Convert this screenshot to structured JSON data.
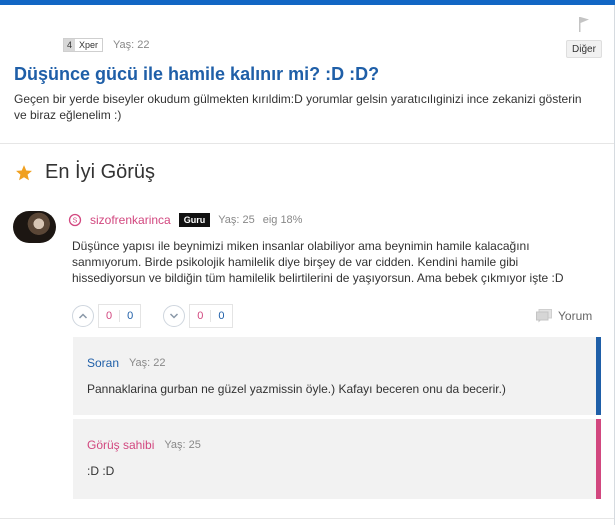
{
  "question": {
    "level": "4",
    "level_name": "Xper",
    "age": "Yaş: 22",
    "other_button": "Diğer",
    "title": "Düşünce gücü ile hamile kalınır mi? :D :D?",
    "body": "Geçen bir yerde biseyler okudum gülmekten kırıldim:D yorumlar gelsin yaratıcılıginizi ince zekanizi gösterin ve biraz eğlenelim :)"
  },
  "best_opinion": {
    "heading": "En İyi Görüş",
    "username": "sizofrenkarinca",
    "rank_badge": "Guru",
    "age": "Yaş: 25",
    "status": "eig 18%",
    "body": "Düşünce yapısı ile beynimizi miken insanlar olabiliyor ama beynimin hamile kalacağını sanmıyorum. Birde psikolojik hamilelik diye birşey de var cidden. Kendini hamile gibi hissediyorsun ve bildiğin tüm hamilelik belirtilerini de yaşıyorsun. Ama bebek çıkmıyor işte :D",
    "upvote": {
      "positive": "0",
      "negative": "0"
    },
    "downvote": {
      "positive": "0",
      "negative": "0"
    },
    "comment_label": "Yorum"
  },
  "replies": [
    {
      "username": "Soran",
      "age": "Yaş: 22",
      "body": "Pannaklarina gurban ne güzel yazmissin öyle.) Kafayı beceren onu da becerir.)"
    },
    {
      "username": "Görüş sahibi",
      "age": "Yaş: 25",
      "body": ":D :D"
    }
  ],
  "colors": {
    "primary": "#1f5fa8",
    "accent_pink": "#d2477f",
    "star": "#f0a020"
  }
}
